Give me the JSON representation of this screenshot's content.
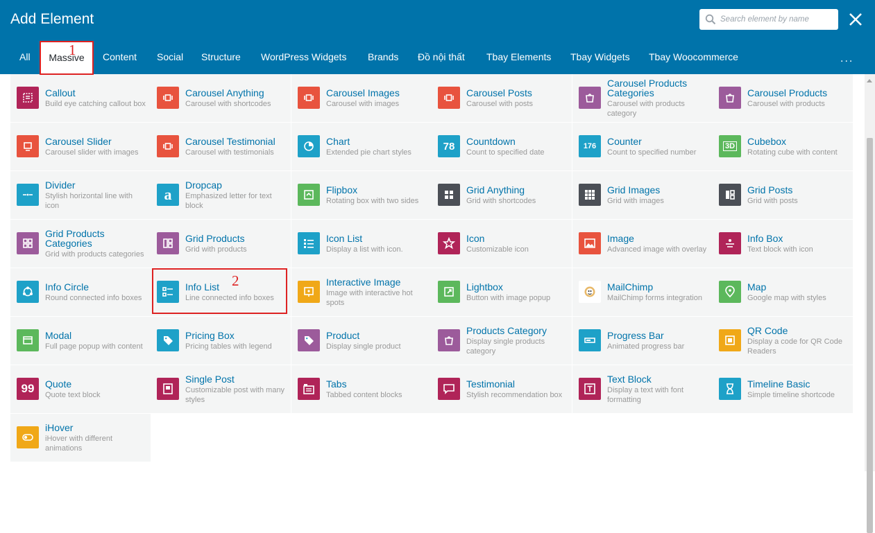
{
  "title": "Add Element",
  "search": {
    "placeholder": "Search element by name"
  },
  "tabs": [
    "All",
    "Massive",
    "Content",
    "Social",
    "Structure",
    "WordPress Widgets",
    "Brands",
    "Đồ nội thất",
    "Tbay Elements",
    "Tbay Widgets",
    "Tbay Woocommerce"
  ],
  "active_tab": "Massive",
  "more_label": "...",
  "annotations": {
    "step1": "1",
    "step2": "2"
  },
  "elements": [
    {
      "name": "Callout",
      "desc": "Build eye catching callout box",
      "color": "#b02458",
      "icon": "callout-icon"
    },
    {
      "name": "Carousel Anything",
      "desc": "Carousel with shortcodes",
      "color": "#e8533e",
      "icon": "carousel-icon"
    },
    {
      "name": "Carousel Images",
      "desc": "Carousel with images",
      "color": "#e8533e",
      "icon": "carousel-icon"
    },
    {
      "name": "Carousel Posts",
      "desc": "Carousel with posts",
      "color": "#e8533e",
      "icon": "carousel-icon"
    },
    {
      "name": "Carousel Products Categories",
      "desc": "Carousel with products category",
      "color": "#9c5b9b",
      "icon": "bag-icon"
    },
    {
      "name": "Carousel Products",
      "desc": "Carousel with products",
      "color": "#9c5b9b",
      "icon": "bag-icon"
    },
    {
      "name": "Carousel Slider",
      "desc": "Carousel slider with images",
      "color": "#e8533e",
      "icon": "slider-icon"
    },
    {
      "name": "Carousel Testimonial",
      "desc": "Carousel with testimonials",
      "color": "#e8533e",
      "icon": "carousel-icon"
    },
    {
      "name": "Chart",
      "desc": "Extended pie chart styles",
      "color": "#1ea1c8",
      "icon": "pie-chart-icon"
    },
    {
      "name": "Countdown",
      "desc": "Count to specified date",
      "color": "#1ea1c8",
      "icon": "countdown-icon",
      "glyph": "78"
    },
    {
      "name": "Counter",
      "desc": "Count to specified number",
      "color": "#1ea1c8",
      "icon": "counter-icon",
      "glyph": "176"
    },
    {
      "name": "Cubebox",
      "desc": "Rotating cube with content",
      "color": "#5cb85c",
      "icon": "cube-icon",
      "glyph": "3D"
    },
    {
      "name": "Divider",
      "desc": "Stylish horizontal line with icon",
      "color": "#1ea1c8",
      "icon": "divider-icon"
    },
    {
      "name": "Dropcap",
      "desc": "Emphasized letter for text block",
      "color": "#1ea1c8",
      "icon": "dropcap-icon",
      "glyph": "a"
    },
    {
      "name": "Flipbox",
      "desc": "Rotating box with two sides",
      "color": "#5cb85c",
      "icon": "flip-icon"
    },
    {
      "name": "Grid Anything",
      "desc": "Grid with shortcodes",
      "color": "#4b4f56",
      "icon": "grid4-icon"
    },
    {
      "name": "Grid Images",
      "desc": "Grid with images",
      "color": "#4b4f56",
      "icon": "grid9-icon"
    },
    {
      "name": "Grid Posts",
      "desc": "Grid with posts",
      "color": "#4b4f56",
      "icon": "grid-posts-icon"
    },
    {
      "name": "Grid Products Categories",
      "desc": "Grid with products categories",
      "color": "#9c5b9b",
      "icon": "grid-products-icon"
    },
    {
      "name": "Grid Products",
      "desc": "Grid with products",
      "color": "#9c5b9b",
      "icon": "grid-columns-icon"
    },
    {
      "name": "Icon List",
      "desc": "Display a list with icon.",
      "color": "#1ea1c8",
      "icon": "list-icon"
    },
    {
      "name": "Icon",
      "desc": "Customizable icon",
      "color": "#b02458",
      "icon": "star-icon"
    },
    {
      "name": "Image",
      "desc": "Advanced image with overlay",
      "color": "#e8533e",
      "icon": "image-icon"
    },
    {
      "name": "Info Box",
      "desc": "Text block with icon",
      "color": "#b02458",
      "icon": "info-box-icon"
    },
    {
      "name": "Info Circle",
      "desc": "Round connected info boxes",
      "color": "#1ea1c8",
      "icon": "info-circle-icon"
    },
    {
      "name": "Info List",
      "desc": "Line connected info boxes",
      "color": "#1ea1c8",
      "icon": "info-list-icon"
    },
    {
      "name": "Interactive Image",
      "desc": "Image with interactive hot spots",
      "color": "#f0a818",
      "icon": "interactive-image-icon"
    },
    {
      "name": "Lightbox",
      "desc": "Button with image popup",
      "color": "#5cb85c",
      "icon": "expand-icon"
    },
    {
      "name": "MailChimp",
      "desc": "MailChimp forms integration",
      "color": "#ffffff",
      "icon": "mailchimp-icon"
    },
    {
      "name": "Map",
      "desc": "Google map with styles",
      "color": "#5cb85c",
      "icon": "map-pin-icon"
    },
    {
      "name": "Modal",
      "desc": "Full page popup with content",
      "color": "#5cb85c",
      "icon": "modal-icon"
    },
    {
      "name": "Pricing Box",
      "desc": "Pricing tables with legend",
      "color": "#1ea1c8",
      "icon": "tag-icon"
    },
    {
      "name": "Product",
      "desc": "Display single product",
      "color": "#9c5b9b",
      "icon": "tag-icon"
    },
    {
      "name": "Products Category",
      "desc": "Display single products category",
      "color": "#9c5b9b",
      "icon": "bag-icon"
    },
    {
      "name": "Progress Bar",
      "desc": "Animated progress bar",
      "color": "#1ea1c8",
      "icon": "progress-bar-icon"
    },
    {
      "name": "QR Code",
      "desc": "Display a code for QR Code Readers",
      "color": "#f0a818",
      "icon": "qr-code-icon"
    },
    {
      "name": "Quote",
      "desc": "Quote text block",
      "color": "#b02458",
      "icon": "quote-icon",
      "glyph": "99"
    },
    {
      "name": "Single Post",
      "desc": "Customizable post with many styles",
      "color": "#b02458",
      "icon": "post-icon"
    },
    {
      "name": "Tabs",
      "desc": "Tabbed content blocks",
      "color": "#b02458",
      "icon": "tabs-icon"
    },
    {
      "name": "Testimonial",
      "desc": "Stylish recommendation box",
      "color": "#b02458",
      "icon": "speech-bubble-icon"
    },
    {
      "name": "Text Block",
      "desc": "Display a text with font formatting",
      "color": "#b02458",
      "icon": "text-block-icon"
    },
    {
      "name": "Timeline Basic",
      "desc": "Simple timeline shortcode",
      "color": "#1ea1c8",
      "icon": "hourglass-icon"
    },
    {
      "name": "iHover",
      "desc": "iHover with different animations",
      "color": "#f0a818",
      "icon": "ihover-icon"
    }
  ]
}
